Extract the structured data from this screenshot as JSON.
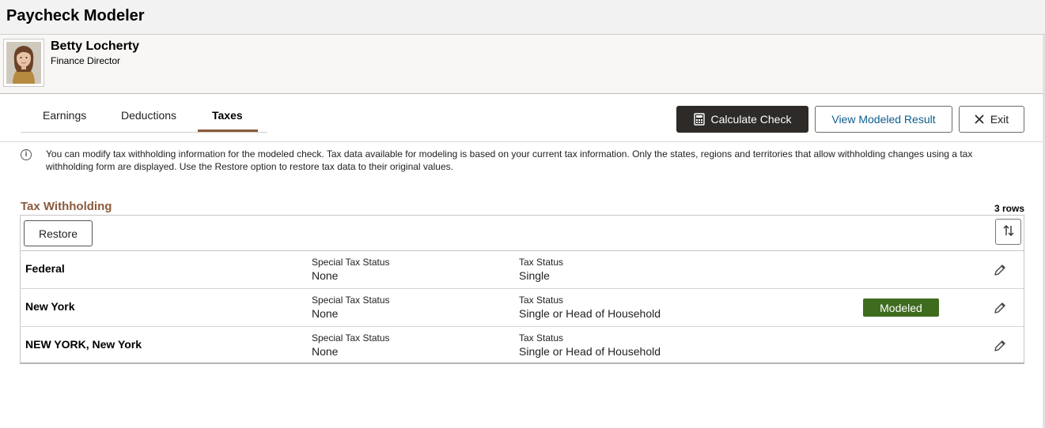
{
  "app": {
    "title": "Paycheck Modeler"
  },
  "employee": {
    "name": "Betty Locherty",
    "role": "Finance Director"
  },
  "tabs": [
    {
      "label": "Earnings",
      "active": false
    },
    {
      "label": "Deductions",
      "active": false
    },
    {
      "label": "Taxes",
      "active": true
    }
  ],
  "actions": {
    "calculate": "Calculate Check",
    "view_result": "View Modeled Result",
    "exit": "Exit"
  },
  "info": {
    "icon": "info-icon",
    "text": "You can modify tax withholding information for the modeled check. Tax data available for modeling is based on your current tax information. Only the states, regions and territories that allow withholding changes using a tax withholding form are displayed. Use the Restore option to restore tax data to their original values."
  },
  "tax_withholding": {
    "title": "Tax Withholding",
    "row_count": "3 rows",
    "restore_label": "Restore",
    "rows": [
      {
        "name": "Federal",
        "special_label": "Special Tax Status",
        "special_value": "None",
        "status_label": "Tax Status",
        "status_value": "Single",
        "badge": ""
      },
      {
        "name": "New York",
        "special_label": "Special Tax Status",
        "special_value": "None",
        "status_label": "Tax Status",
        "status_value": "Single or Head of Household",
        "badge": "Modeled"
      },
      {
        "name": "NEW YORK, New York",
        "special_label": "Special Tax Status",
        "special_value": "None",
        "status_label": "Tax Status",
        "status_value": "Single or Head of Household",
        "badge": ""
      }
    ]
  },
  "colors": {
    "accent": "#8a5a3c",
    "dark_button": "#2d2a27",
    "link": "#0c5d8f",
    "modeled_badge": "#3f6b1f"
  }
}
